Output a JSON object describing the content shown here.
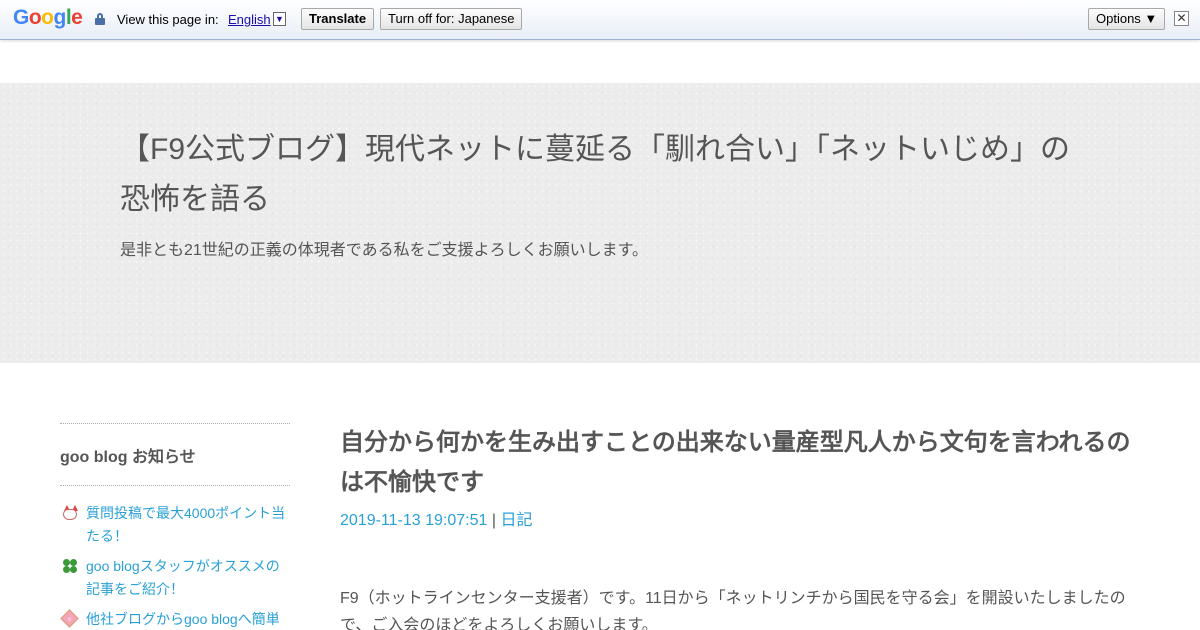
{
  "translate_bar": {
    "logo": {
      "letters": [
        "G",
        "o",
        "o",
        "g",
        "l",
        "e"
      ],
      "colors": [
        "#4285f4",
        "#ea4335",
        "#fbbc05",
        "#4285f4",
        "#34a853",
        "#ea4335"
      ]
    },
    "view_text": "View this page in:",
    "language": "English",
    "dropdown_glyph": "▼",
    "translate_label": "Translate",
    "turnoff_label": "Turn off for: Japanese",
    "options_label": "Options ▼",
    "close_glyph": "✕"
  },
  "header": {
    "title": "【F9公式ブログ】現代ネットに蔓延る「馴れ合い」「ネットいじめ」の恐怖を語る",
    "description": "是非とも21世紀の正義の体現者である私をご支援よろしくお願いします。"
  },
  "sidebar": {
    "heading": "goo blog お知らせ",
    "items": [
      {
        "label": "質問投稿で最大4000ポイント当たる！",
        "icon": "fox-icon"
      },
      {
        "label": "goo blogスタッフがオススメの記事をご紹介！",
        "icon": "clover-icon"
      },
      {
        "label": "他社ブログからgoo blogへ簡単",
        "icon": "flower-icon"
      }
    ]
  },
  "post": {
    "title": "自分から何かを生み出すことの出来ない量産型凡人から文句を言われるのは不愉快です",
    "date": "2019-11-13 19:07:51",
    "separator": "|",
    "category": "日記",
    "body": "F9（ホットラインセンター支援者）です。11日から「ネットリンチから国民を守る会」を開設いたしましたので、ご入会のほどをよろしくお願いします。"
  },
  "colors": {
    "link": "#2aa0d8",
    "text": "#555555",
    "header_bg": "#ececec"
  }
}
